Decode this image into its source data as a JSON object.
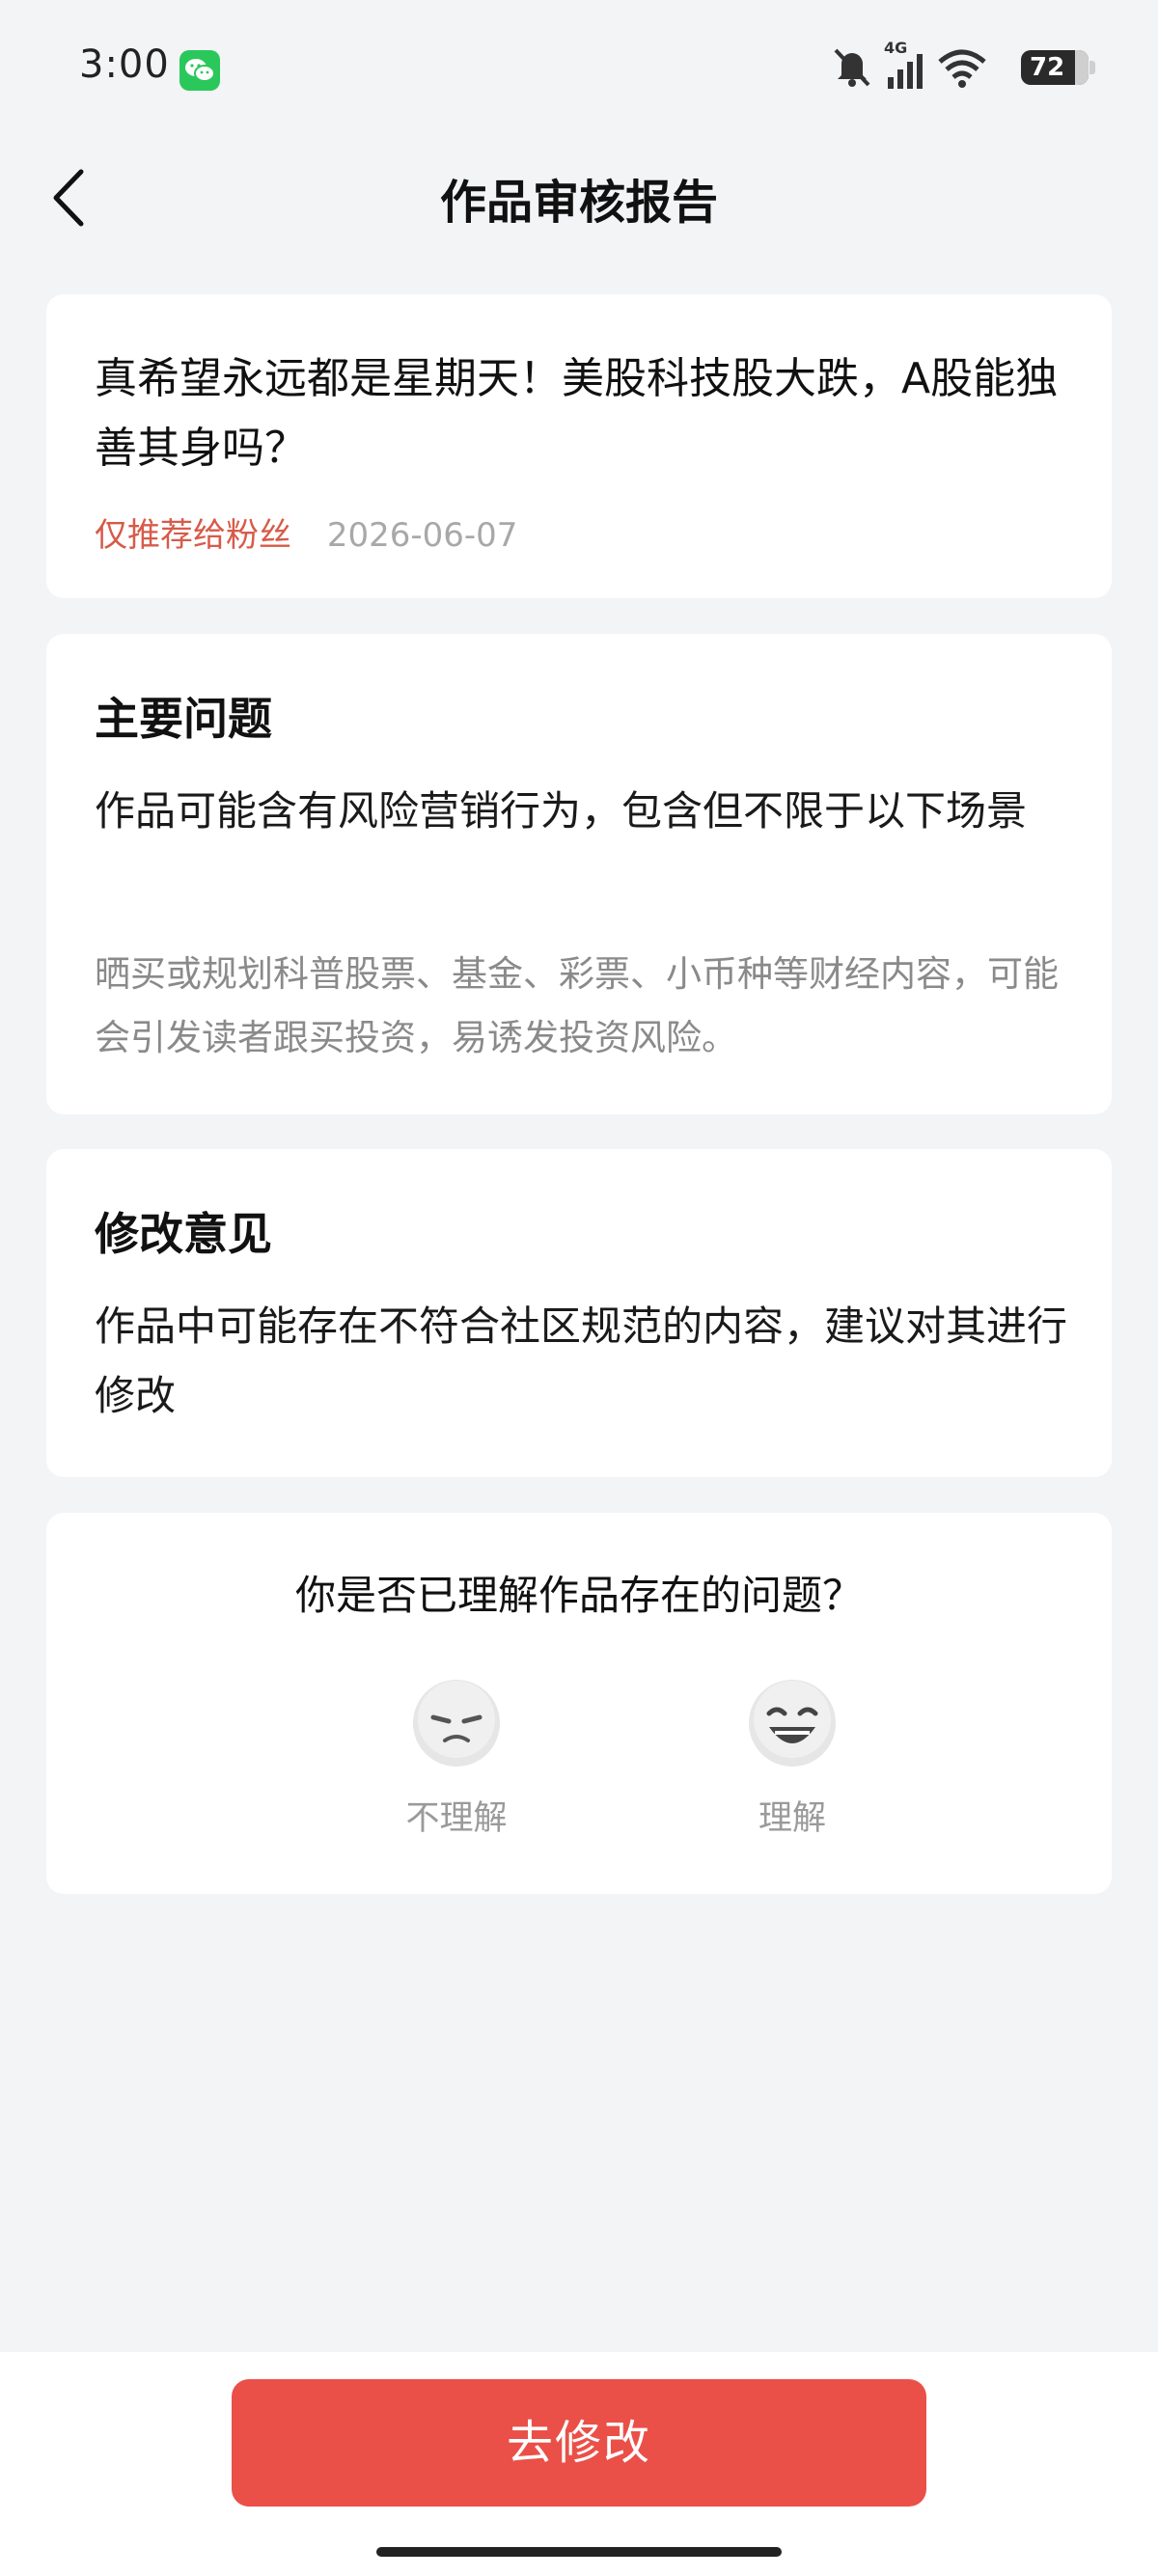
{
  "status_bar": {
    "time": "3:00",
    "network": "4G",
    "battery": "72"
  },
  "header": {
    "title": "作品审核报告",
    "back_icon": "chevron-left-icon"
  },
  "work": {
    "title": "真希望永远都是星期天！美股科技股大跌，A股能独善其身吗？",
    "visibility_tag": "仅推荐给粉丝",
    "date": "2026-06-07",
    "tag_color": "#d75b49"
  },
  "main_issue": {
    "heading": "主要问题",
    "text": "作品可能含有风险营销行为，包含但不限于以下场景",
    "detail": "晒买或规划科普股票、基金、彩票、小币种等财经内容，可能会引发读者跟买投资，易诱发投资风险。"
  },
  "suggestion": {
    "heading": "修改意见",
    "text": "作品中可能存在不符合社区规范的内容，建议对其进行修改"
  },
  "feedback": {
    "question": "你是否已理解作品存在的问题？",
    "not_understand_label": "不理解",
    "understand_label": "理解",
    "not_understand_icon": "frown-emoji-icon",
    "understand_icon": "laugh-emoji-icon"
  },
  "footer": {
    "primary_label": "去修改",
    "primary_color": "#ea5048"
  }
}
